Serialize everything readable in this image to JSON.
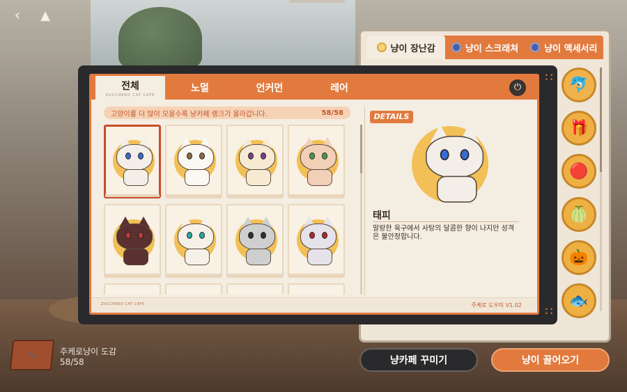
{
  "main_tabs": [
    {
      "label": "전체",
      "sub": "ZUCCHERO CAT CAFE"
    },
    {
      "label": "노멀",
      "sub": ""
    },
    {
      "label": "언커먼",
      "sub": ""
    },
    {
      "label": "레어",
      "sub": ""
    }
  ],
  "notice": {
    "text": "고양이를 더 많이 모을수록 냥카페 랭크가 올라갑니다.",
    "count": "58/58"
  },
  "details": {
    "badge": "DETAILS",
    "name": "태피",
    "description": "말랑한 육구에서 사탕의 달콤한 향이 나지만 성격은 불안정합니다."
  },
  "cats": [
    {
      "fur": "#f3efe8",
      "eye": "#3a6bd1",
      "icon": "sunglasses"
    },
    {
      "fur": "#fbf7f2",
      "eye": "#8a6b4a",
      "icon": "round-glasses"
    },
    {
      "fur": "#f7ead2",
      "eye": "#7a3f8c",
      "icon": "bow"
    },
    {
      "fur": "#f2d0b8",
      "eye": "#4a9a4a",
      "icon": "ribbon"
    },
    {
      "fur": "#5a3030",
      "eye": "#c23a3a",
      "icon": "none"
    },
    {
      "fur": "#f6f1e8",
      "eye": "#2aa6a0",
      "icon": "leaf"
    },
    {
      "fur": "#cfcfcf",
      "eye": "#2f2f2f",
      "icon": "headband"
    },
    {
      "fur": "#e6e2ea",
      "eye": "#b02a2a",
      "icon": "none"
    }
  ],
  "side_tabs": [
    "냥이 장난감",
    "냥이 스크래쳐",
    "냥이 액세서리"
  ],
  "toys": [
    "dolphin-toy",
    "gift-box-toy",
    "yarn-ball-toy",
    "melon-toy",
    "pumpkin-toy",
    "fish-toy"
  ],
  "footer": {
    "brand": "ZUCCHERO CAT CAFE",
    "version": "주케로 도우미 V1.02"
  },
  "book": {
    "title": "주케로냥이 도감",
    "count": "58/58"
  },
  "buttons": {
    "decorate": "냥카페 꾸미기",
    "attract": "냥이 끌어오기"
  }
}
